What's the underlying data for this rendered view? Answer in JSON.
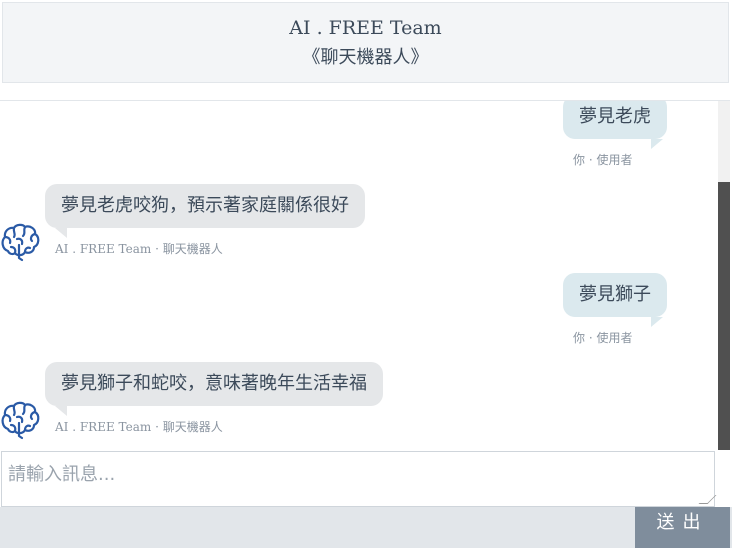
{
  "header": {
    "title": "AI . FREE Team",
    "subtitle": "《聊天機器人》"
  },
  "messages": [
    {
      "sender": "user",
      "text": "夢見老虎",
      "meta": "你 · 使用者"
    },
    {
      "sender": "bot",
      "text": "夢見老虎咬狗，預示著家庭關係很好",
      "meta": "AI . FREE Team · 聊天機器人"
    },
    {
      "sender": "user",
      "text": "夢見獅子",
      "meta": "你 · 使用者"
    },
    {
      "sender": "bot",
      "text": "夢見獅子和蛇咬，意味著晚年生活幸福",
      "meta": "AI . FREE Team · 聊天機器人"
    }
  ],
  "input": {
    "placeholder": "請輸入訊息..."
  },
  "send_button": {
    "label": "送出"
  },
  "icons": {
    "bot_avatar": "brain-icon"
  },
  "colors": {
    "user_bubble": "#dbe9ee",
    "bot_bubble": "#e5e7e9",
    "send_button": "#7f8d9c",
    "brain": "#2a5aa6"
  }
}
